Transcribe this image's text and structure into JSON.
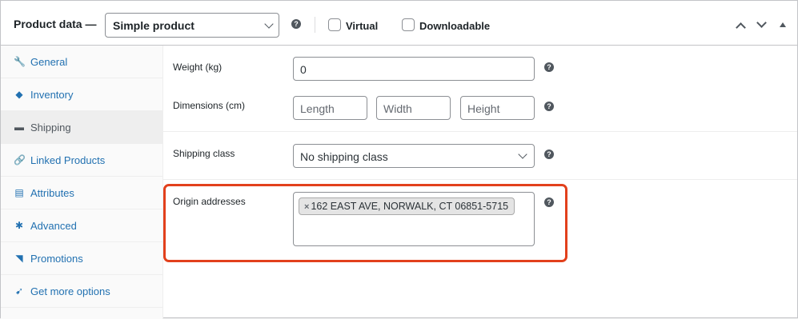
{
  "header": {
    "title": "Product data —",
    "product_type": "Simple product",
    "virtual_label": "Virtual",
    "downloadable_label": "Downloadable",
    "help_glyph": "?"
  },
  "sidebar": {
    "items": [
      {
        "label": "General",
        "icon": "wrench-icon",
        "glyph": "🔧",
        "active": false
      },
      {
        "label": "Inventory",
        "icon": "tag-icon",
        "glyph": "◆",
        "active": false
      },
      {
        "label": "Shipping",
        "icon": "truck-icon",
        "glyph": "▬",
        "active": true
      },
      {
        "label": "Linked Products",
        "icon": "link-icon",
        "glyph": "🔗",
        "active": false
      },
      {
        "label": "Attributes",
        "icon": "list-icon",
        "glyph": "▤",
        "active": false
      },
      {
        "label": "Advanced",
        "icon": "gear-icon",
        "glyph": "✱",
        "active": false
      },
      {
        "label": "Promotions",
        "icon": "pin-icon",
        "glyph": "◥",
        "active": false
      },
      {
        "label": "Get more options",
        "icon": "plugin-icon",
        "glyph": "➹",
        "active": false
      }
    ]
  },
  "shipping": {
    "weight_label": "Weight (kg)",
    "weight_value": "0",
    "dimensions_label": "Dimensions (cm)",
    "length_placeholder": "Length",
    "width_placeholder": "Width",
    "height_placeholder": "Height",
    "shipping_class_label": "Shipping class",
    "shipping_class_value": "No shipping class",
    "origin_label": "Origin addresses",
    "origin_remove_glyph": "×",
    "origin_address": "162 EAST AVE, NORWALK, CT 06851-5715"
  },
  "colors": {
    "accent": "#2271b1",
    "highlight": "#e2401c"
  }
}
